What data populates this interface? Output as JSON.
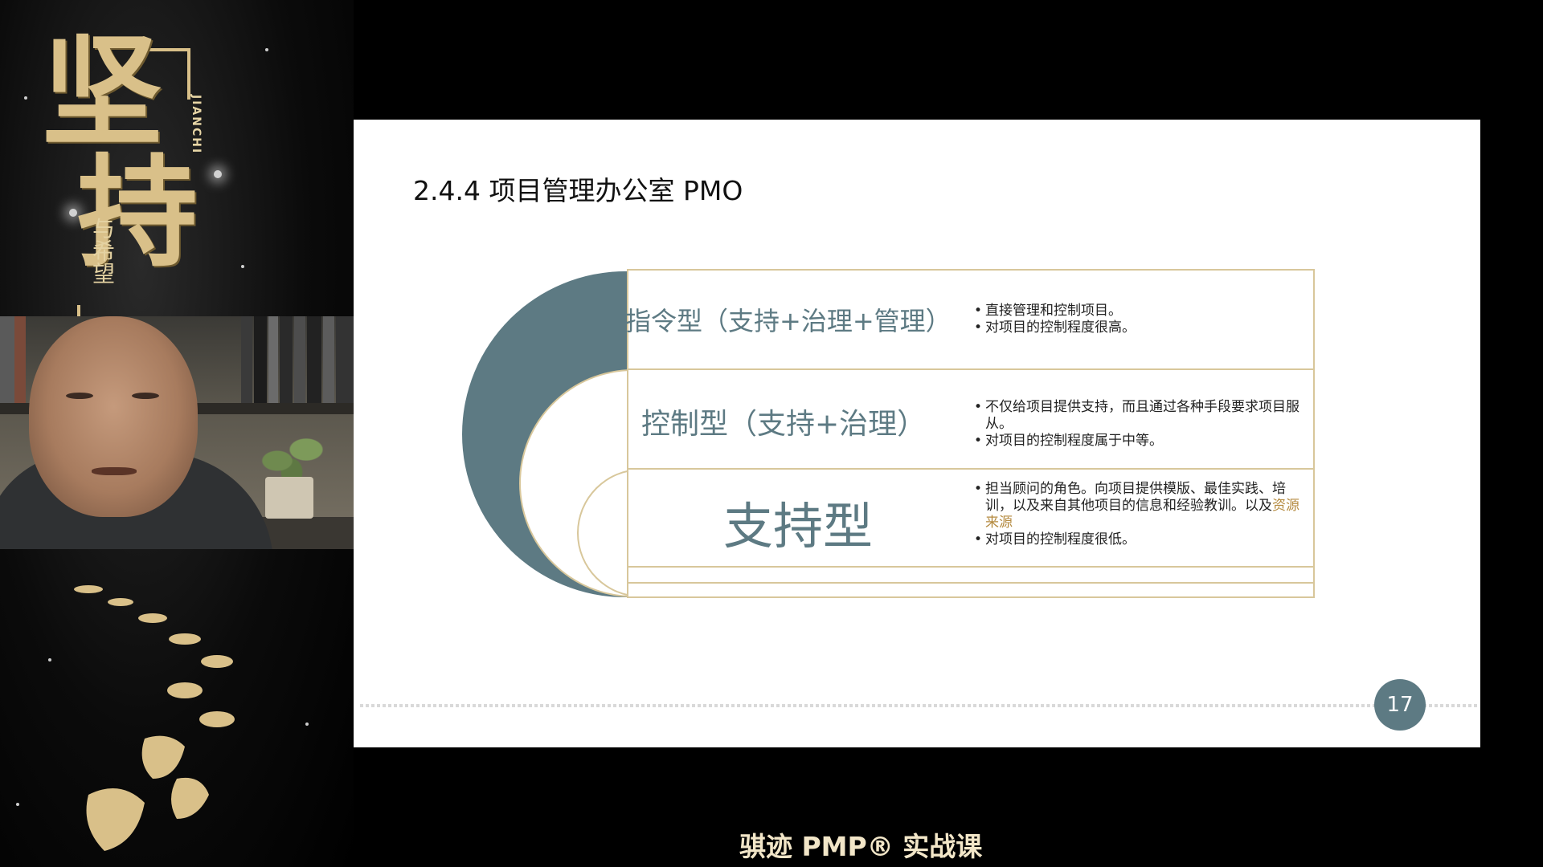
{
  "poster": {
    "title_chars": [
      "坚",
      "持"
    ],
    "pinyin": "JIANCHI",
    "subtitle": "与希望"
  },
  "slide": {
    "title": "2.4.4 项目管理办公室 PMO",
    "rows": [
      {
        "label": "指令型（支持+治理+管理）",
        "bullets": [
          "直接管理和控制项目。",
          "对项目的控制程度很高。"
        ]
      },
      {
        "label": "控制型（支持+治理）",
        "bullets": [
          "不仅给项目提供支持，而且通过各种手段要求项目服从。",
          "对项目的控制程度属于中等。"
        ]
      },
      {
        "label": "支持型",
        "bullets_first_plain": "担当顾问的角色。向项目提供模版、最佳实践、培训，以及来自其他项目的信息和经验教训。以及",
        "bullets_first_highlight": "资源来源",
        "bullets_second": "对项目的控制程度很低。"
      }
    ],
    "page_number": "17"
  },
  "watermark": "骐迹 PMP® 实战课",
  "colors": {
    "teal": "#5d7a83",
    "gold": "#d8c79b",
    "highlight": "#b48a3f"
  }
}
